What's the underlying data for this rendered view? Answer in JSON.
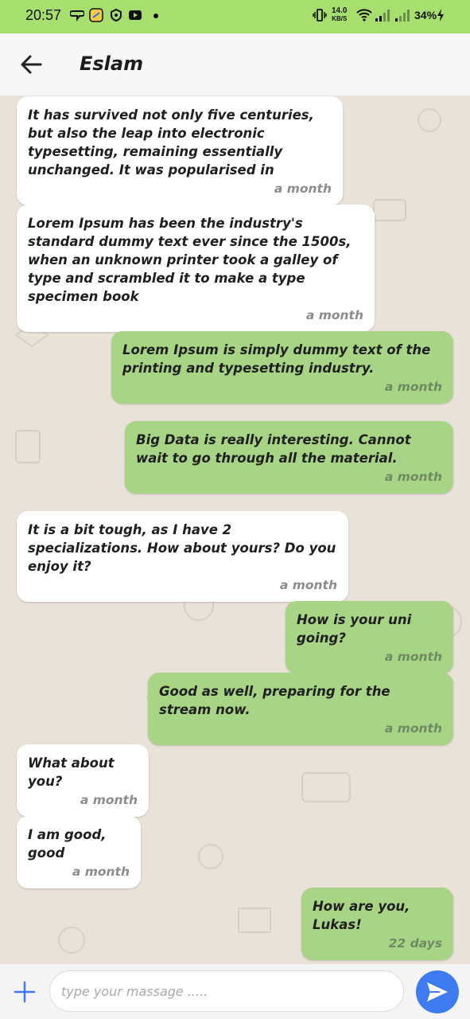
{
  "status_bar": {
    "time": "20:57",
    "net_speed_value": "14.0",
    "net_speed_unit": "KB/S",
    "battery": "34%",
    "icons": [
      "chat-notification-icon",
      "app-notification-icon",
      "shield-icon",
      "youtube-icon",
      "vibrate-icon",
      "wifi-icon",
      "signal-icon",
      "signal-icon-2",
      "charging-icon"
    ]
  },
  "header": {
    "title": "Eslam",
    "back_icon": "arrow-left-icon"
  },
  "messages": [
    {
      "direction": "in",
      "text": "It has survived not only five centuries, but also the leap into electronic typesetting, remaining essentially unchanged. It was popularised in",
      "time": "a month"
    },
    {
      "direction": "in",
      "text": "Lorem Ipsum has been the industry's standard dummy text ever since the 1500s, when an unknown printer took a galley of type and scrambled it to make a type specimen book",
      "time": "a month"
    },
    {
      "direction": "out",
      "text": "Lorem Ipsum is simply dummy text of the printing and typesetting industry.",
      "time": "a month"
    },
    {
      "direction": "out",
      "text": "Big Data is really interesting. Cannot wait to go through all the material.",
      "time": "a month"
    },
    {
      "direction": "in",
      "text": "It is a bit tough, as I have 2 specializations. How about yours? Do you enjoy it?",
      "time": "a month"
    },
    {
      "direction": "out",
      "text": "How is your uni going?",
      "time": "a month"
    },
    {
      "direction": "out",
      "text": "Good as well, preparing for the stream now.",
      "time": "a month"
    },
    {
      "direction": "in",
      "text": "What about you?",
      "time": "a month"
    },
    {
      "direction": "in",
      "text": "I am good, good",
      "time": "a month"
    },
    {
      "direction": "out",
      "text": "How are you, Lukas!",
      "time": "22 days"
    }
  ],
  "composer": {
    "placeholder": "type your massage .....",
    "value": "",
    "add_icon": "plus-icon",
    "send_icon": "send-icon"
  },
  "colors": {
    "status_bar": "#a6df6e",
    "outgoing_bubble": "#a8d585",
    "incoming_bubble": "#ffffff",
    "send_button": "#3f7bf0",
    "chat_background": "#e9e2d8"
  }
}
